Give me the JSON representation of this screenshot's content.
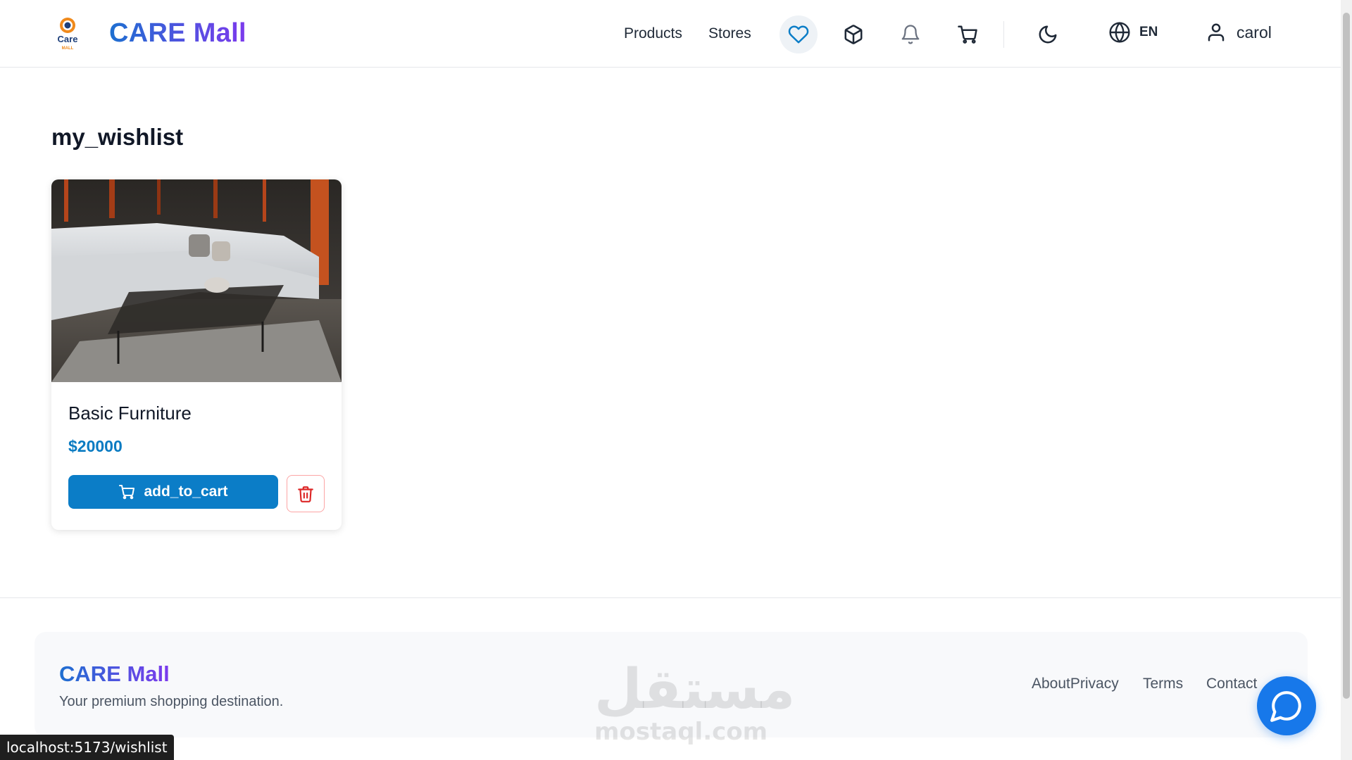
{
  "header": {
    "brand": "CARE Mall",
    "logo_text": "Care",
    "logo_subtext": "MALL",
    "nav": {
      "products": "Products",
      "stores": "Stores"
    },
    "language": "EN",
    "username": "carol"
  },
  "main": {
    "title": "my_wishlist",
    "items": [
      {
        "name": "Basic Furniture",
        "price": "$20000",
        "add_label": "add_to_cart"
      }
    ]
  },
  "footer": {
    "brand": "CARE Mall",
    "tagline": "Your premium shopping destination.",
    "links": {
      "about_privacy": "AboutPrivacy",
      "terms": "Terms",
      "contact": "Contact"
    }
  },
  "watermark": {
    "arabic": "مستقل",
    "latin": "mostaql.com"
  },
  "status_bar": {
    "url": "localhost:5173/wishlist"
  },
  "colors": {
    "accent": "#0b7dc7",
    "price": "#0a7bc2",
    "brand_start": "#1d6fd0",
    "brand_end": "#7c3aed",
    "danger": "#dc2626",
    "chat": "#1778ea"
  },
  "icons": [
    "heart-icon",
    "box-icon",
    "bell-icon",
    "cart-icon",
    "moon-icon",
    "globe-icon",
    "user-icon",
    "trash-icon",
    "chat-icon"
  ]
}
